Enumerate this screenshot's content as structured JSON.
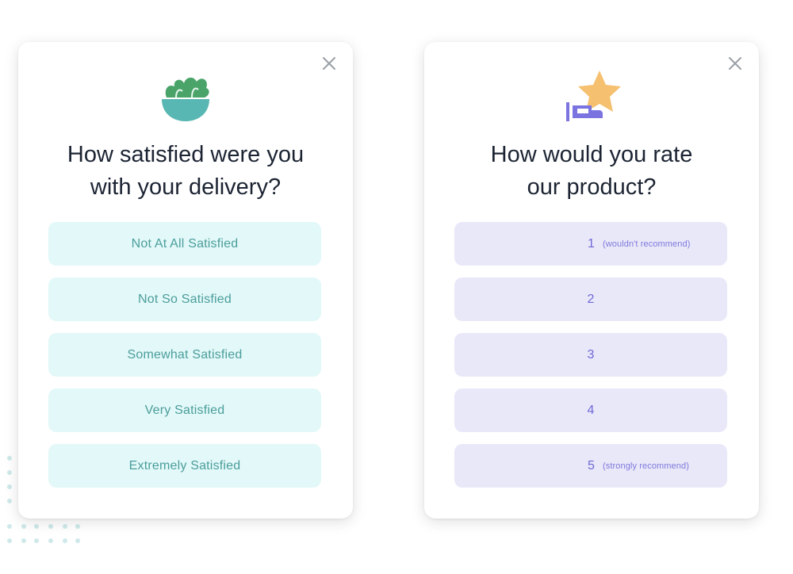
{
  "colors": {
    "teal_option_bg": "#e3f8f8",
    "teal_option_text": "#4a9e9c",
    "purple_option_bg": "#e9e8f9",
    "purple_option_text": "#6f68d6",
    "question_text": "#1c2433",
    "close_icon": "#9aa0a6"
  },
  "delivery_survey": {
    "illustration_icon": "salad-bowl-icon",
    "close_icon": "close-icon",
    "question": "How satisfied were you\nwith your delivery?",
    "options": [
      {
        "label": "Not At All Satisfied"
      },
      {
        "label": "Not So Satisfied"
      },
      {
        "label": "Somewhat Satisfied"
      },
      {
        "label": "Very Satisfied"
      },
      {
        "label": "Extremely Satisfied"
      }
    ]
  },
  "product_survey": {
    "illustration_icon": "star-rating-icon",
    "close_icon": "close-icon",
    "question": "How would you rate\nour product?",
    "options": [
      {
        "number": "1",
        "hint": "(wouldn't recommend)"
      },
      {
        "number": "2",
        "hint": ""
      },
      {
        "number": "3",
        "hint": ""
      },
      {
        "number": "4",
        "hint": ""
      },
      {
        "number": "5",
        "hint": "(strongly recommend)"
      }
    ]
  }
}
